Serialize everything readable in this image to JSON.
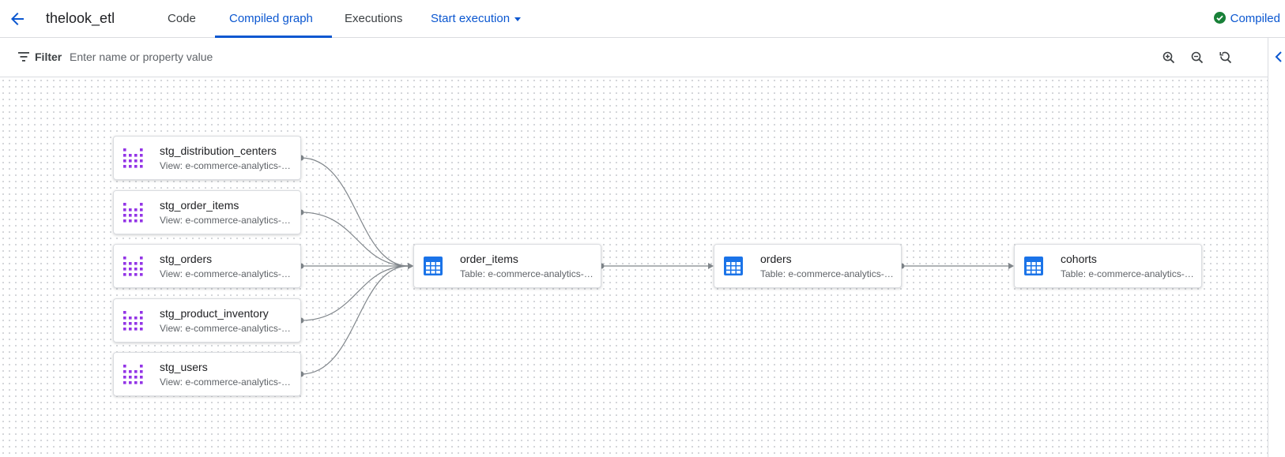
{
  "header": {
    "back_icon": "arrow-back-icon",
    "title": "thelook_etl",
    "tabs": [
      {
        "label": "Code"
      },
      {
        "label": "Compiled graph"
      },
      {
        "label": "Executions"
      }
    ],
    "active_tab": "Compiled graph",
    "start_execution": "Start execution",
    "status": {
      "label": "Compiled",
      "icon": "check-circle-icon",
      "color": "#188038"
    }
  },
  "filter": {
    "label": "Filter",
    "placeholder": "Enter name or property value",
    "icons": [
      "filter-list-icon",
      "zoom-in-icon",
      "zoom-out-icon",
      "zoom-reset-icon"
    ]
  },
  "graph": {
    "colors": {
      "view_icon": "#9334e6",
      "table_icon": "#1a73e8",
      "edge": "#80868b"
    },
    "nodes": [
      {
        "name": "stg_distribution_centers",
        "desc": "View: e-commerce-analytics-3…",
        "kind": "view"
      },
      {
        "name": "stg_order_items",
        "desc": "View: e-commerce-analytics-3…",
        "kind": "view"
      },
      {
        "name": "stg_orders",
        "desc": "View: e-commerce-analytics-3…",
        "kind": "view"
      },
      {
        "name": "stg_product_inventory",
        "desc": "View: e-commerce-analytics-3…",
        "kind": "view"
      },
      {
        "name": "stg_users",
        "desc": "View: e-commerce-analytics-3…",
        "kind": "view"
      },
      {
        "name": "order_items",
        "desc": "Table: e-commerce-analytics-…",
        "kind": "table"
      },
      {
        "name": "orders",
        "desc": "Table: e-commerce-analytics-…",
        "kind": "table"
      },
      {
        "name": "cohorts",
        "desc": "Table: e-commerce-analytics-…",
        "kind": "table"
      }
    ],
    "edges": [
      {
        "from": "stg_distribution_centers",
        "to": "order_items"
      },
      {
        "from": "stg_order_items",
        "to": "order_items"
      },
      {
        "from": "stg_orders",
        "to": "order_items"
      },
      {
        "from": "stg_product_inventory",
        "to": "order_items"
      },
      {
        "from": "stg_users",
        "to": "order_items"
      },
      {
        "from": "order_items",
        "to": "orders"
      },
      {
        "from": "orders",
        "to": "cohorts"
      }
    ]
  }
}
